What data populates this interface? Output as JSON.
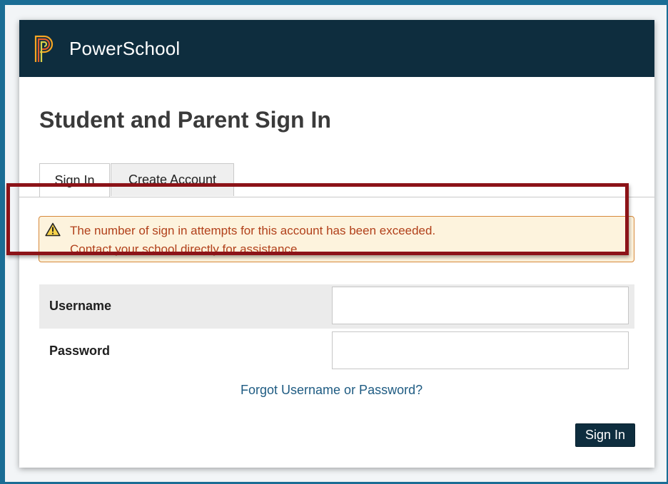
{
  "brand": {
    "name": "PowerSchool",
    "logo_icon": "powerschool-p-logo"
  },
  "page": {
    "title": "Student and Parent Sign In"
  },
  "tabs": [
    {
      "label": "Sign In",
      "active": true
    },
    {
      "label": "Create Account",
      "active": false
    }
  ],
  "alert": {
    "icon": "warning-triangle-icon",
    "line1": "The number of sign in attempts for this account has been exceeded.",
    "line2": "Contact your school directly for assistance."
  },
  "form": {
    "username": {
      "label": "Username",
      "value": ""
    },
    "password": {
      "label": "Password",
      "value": ""
    },
    "forgot_link": "Forgot Username or Password?",
    "submit_label": "Sign In"
  },
  "colors": {
    "header_bg": "#0e2d3e",
    "frame": "#1a6d95",
    "highlight_border": "#8c1318",
    "alert_bg": "#fdf3dd",
    "alert_text": "#b1401a",
    "link": "#1e5b82"
  }
}
